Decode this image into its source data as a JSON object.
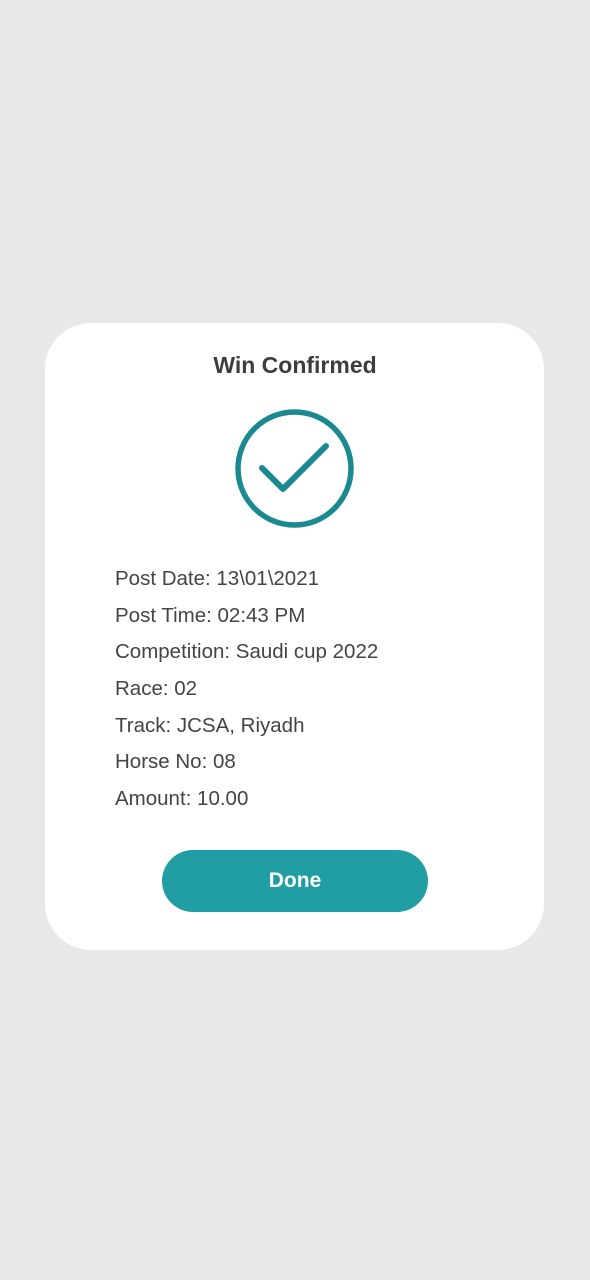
{
  "dialog": {
    "title": "Win Confirmed",
    "icon": "check-circle-icon",
    "accent_color": "#1b8a90",
    "details": [
      {
        "text": "Post Date: 13\\01\\2021"
      },
      {
        "text": "Post Time: 02:43 PM"
      },
      {
        "text": "Competition: Saudi cup 2022"
      },
      {
        "text": "Race: 02"
      },
      {
        "text": "Track: JCSA, Riyadh"
      },
      {
        "text": "Horse No: 08"
      },
      {
        "text": "Amount: 10.00"
      }
    ],
    "done_label": "Done",
    "button_color": "#219ea4"
  }
}
